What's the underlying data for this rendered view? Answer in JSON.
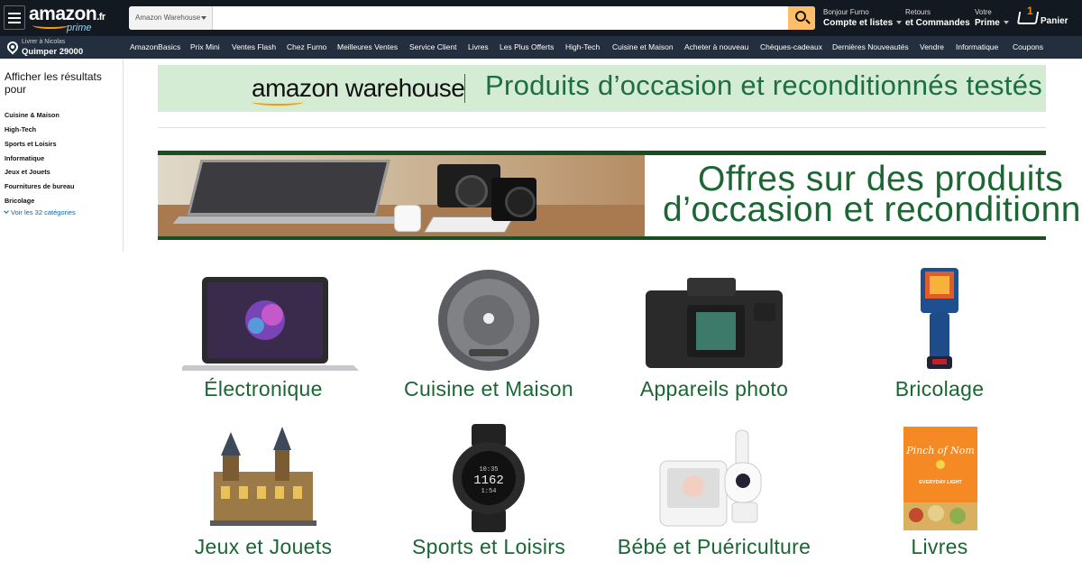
{
  "header": {
    "logo_text": "amazon",
    "logo_tld": ".fr",
    "logo_sub": "prime",
    "search": {
      "department": "Amazon Warehouse",
      "value": "",
      "placeholder": ""
    },
    "account": {
      "line1": "Bonjour Furno",
      "line2": "Compte et listes"
    },
    "orders": {
      "line1": "Retours",
      "line2": "et Commandes"
    },
    "prime": {
      "line1": "Votre",
      "line2": "Prime"
    },
    "cart": {
      "count": "1",
      "label": "Panier"
    }
  },
  "navbar": {
    "deliver_line1": "Livrer à Nicolas",
    "deliver_line2": "Quimper 29000",
    "items": [
      "AmazonBasics",
      "Prix Mini",
      "Ventes Flash",
      "Chez Furno",
      "Meilleures Ventes",
      "Service Client",
      "Livres",
      "Les Plus Offerts",
      "High-Tech",
      "Cuisine et Maison",
      "Acheter à nouveau",
      "Chèques-cadeaux",
      "Dernières Nouveautés",
      "Vendre",
      "Informatique",
      "Coupons"
    ]
  },
  "sidebar": {
    "title": "Afficher les résultats pour",
    "items": [
      "Cuisine & Maison",
      "High-Tech",
      "Sports et Loisirs",
      "Informatique",
      "Jeux et Jouets",
      "Fournitures de bureau",
      "Bricolage"
    ],
    "more": "Voir les 32 catégories"
  },
  "warehouse_banner": {
    "logo": "amazon warehouse",
    "tagline": "Produits d’occasion et reconditionnés testés"
  },
  "offers_banner": {
    "line1": "Offres sur des produits",
    "line2": "d’occasion et reconditionnés"
  },
  "categories": [
    "Électronique",
    "Cuisine et Maison",
    "Appareils photo",
    "Bricolage",
    "Jeux et Jouets",
    "Sports et Loisirs",
    "Bébé et Puériculture",
    "Livres"
  ],
  "watch_display": {
    "top": "10:35",
    "main": "1162",
    "sub": "1:54"
  },
  "book_cover": {
    "title": "Pinch of Nom",
    "subtitle": "EVERYDAY LIGHT"
  },
  "colors": {
    "header_bg": "#131921",
    "nav_bg": "#232f3e",
    "search_button": "#febd69",
    "brand_green": "#1b6633",
    "banner_green": "#d4ebd4",
    "link_blue": "#0066c0"
  }
}
